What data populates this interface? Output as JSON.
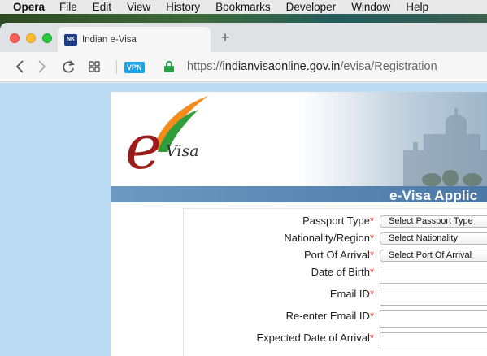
{
  "menubar": {
    "items": [
      "Opera",
      "File",
      "Edit",
      "View",
      "History",
      "Bookmarks",
      "Developer",
      "Window",
      "Help"
    ]
  },
  "browser": {
    "tab": {
      "title": "Indian e-Visa",
      "favicon_text": "NK"
    },
    "new_tab_label": "+",
    "vpn_label": "VPN",
    "url": {
      "scheme": "https://",
      "host": "indianvisaonline.gov.in",
      "path": "/evisa/Registration"
    },
    "icons": [
      "back-icon",
      "forward-icon",
      "reload-icon",
      "speed-dial-icon",
      "lock-icon"
    ]
  },
  "page": {
    "logo_text": "Visa",
    "logo_letter": "e",
    "title": "e-Visa Applic",
    "form": {
      "required_marker": "*",
      "fields": [
        {
          "label": "Passport Type",
          "type": "select",
          "value": "Select Passport Type"
        },
        {
          "label": "Nationality/Region",
          "type": "select",
          "value": "Select Nationality"
        },
        {
          "label": "Port Of Arrival",
          "type": "select",
          "value": "Select Port Of Arrival"
        },
        {
          "label": "Date of Birth",
          "type": "input",
          "value": ""
        },
        {
          "label": "Email ID",
          "type": "input",
          "value": ""
        },
        {
          "label": "Re-enter Email ID",
          "type": "input",
          "value": ""
        },
        {
          "label": "Expected Date of Arrival",
          "type": "input",
          "value": ""
        }
      ]
    }
  },
  "colors": {
    "accent_blue": "#4b78a6",
    "required_red": "#dd1111",
    "page_background": "#bcdcf3",
    "ssl_green": "#2a9d48"
  }
}
